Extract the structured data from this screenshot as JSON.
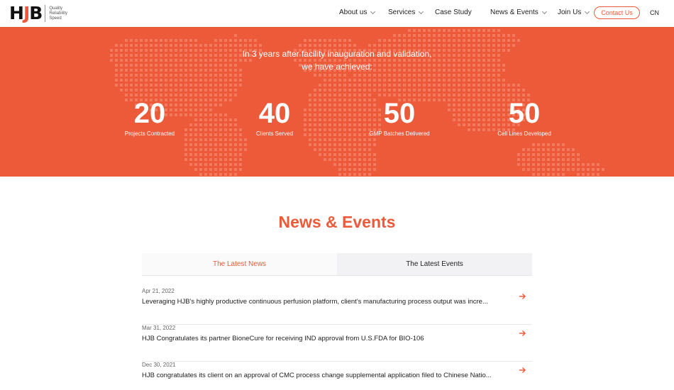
{
  "header": {
    "logo_text_h": "H",
    "logo_text_j": "J",
    "logo_text_b": "B",
    "tagline": [
      "Quality",
      "Reliability",
      "Speed"
    ],
    "nav": [
      {
        "label": "About us",
        "has_dropdown": true
      },
      {
        "label": "Services",
        "has_dropdown": true
      },
      {
        "label": "Case Study",
        "has_dropdown": false
      },
      {
        "label": "News & Events",
        "has_dropdown": true
      },
      {
        "label": "Join Us",
        "has_dropdown": true
      }
    ],
    "contact_label": "Contact Us",
    "lang_label": "CN"
  },
  "hero": {
    "line1": "In 3 years after facility inauguration and validation,",
    "line2": "we have achieved:",
    "stats": [
      {
        "value": "20",
        "label": "Projects Contracted"
      },
      {
        "value": "40",
        "label": "Clients Served"
      },
      {
        "value": "50",
        "label": "GMP Batches Delivered"
      },
      {
        "value": "50",
        "label": "Cell Lines Developed"
      }
    ]
  },
  "news": {
    "title": "News & Events",
    "tabs": [
      {
        "label": "The Latest News",
        "active": true
      },
      {
        "label": "The Latest Events",
        "active": false
      }
    ],
    "items": [
      {
        "date": "Apr 21, 2022",
        "title": "Leveraging HJB's highly productive continuous perfusion platform, client's manufacturing process output was incre..."
      },
      {
        "date": "Mar 31, 2022",
        "title": "HJB Congratulates its partner BioneCure for receiving IND approval from U.S.FDA for BIO-106"
      },
      {
        "date": "Dec 30, 2021",
        "title": "HJB congratulates its client on an approval of CMC process change supplemental application filed to Chinese Natio..."
      }
    ]
  },
  "colors": {
    "accent": "#ec5a3a",
    "map_dot": "#f27a5e"
  }
}
